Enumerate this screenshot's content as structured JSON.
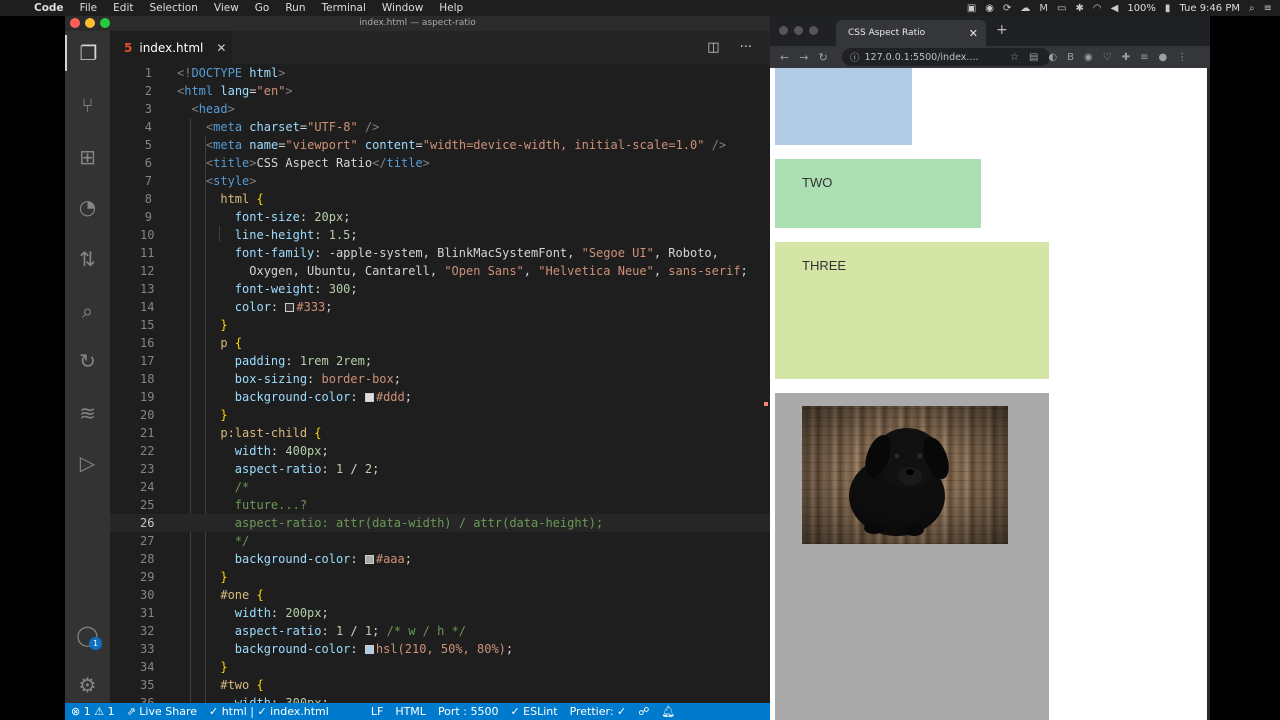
{
  "menubar": {
    "apple": "",
    "items": [
      "Code",
      "File",
      "Edit",
      "Selection",
      "View",
      "Go",
      "Run",
      "Terminal",
      "Window",
      "Help"
    ],
    "battery": "100%",
    "clock": "Tue 9:46 PM"
  },
  "vscode": {
    "window_title": "index.html — aspect-ratio",
    "tab_label": "index.html",
    "activity_badge": "1",
    "lines": [
      {
        "n": "1"
      },
      {
        "n": "2"
      },
      {
        "n": "3"
      },
      {
        "n": "4"
      },
      {
        "n": "5"
      },
      {
        "n": "6"
      },
      {
        "n": "7"
      },
      {
        "n": "8"
      },
      {
        "n": "9"
      },
      {
        "n": "10"
      },
      {
        "n": "11"
      },
      {
        "n": "12"
      },
      {
        "n": "13"
      },
      {
        "n": "14"
      },
      {
        "n": "15"
      },
      {
        "n": "16"
      },
      {
        "n": "17"
      },
      {
        "n": "18"
      },
      {
        "n": "19"
      },
      {
        "n": "20"
      },
      {
        "n": "21"
      },
      {
        "n": "22"
      },
      {
        "n": "23"
      },
      {
        "n": "24"
      },
      {
        "n": "25"
      },
      {
        "n": "26"
      },
      {
        "n": "27"
      },
      {
        "n": "28"
      },
      {
        "n": "29"
      },
      {
        "n": "30"
      },
      {
        "n": "31"
      },
      {
        "n": "32"
      },
      {
        "n": "33"
      },
      {
        "n": "34"
      },
      {
        "n": "35"
      },
      {
        "n": "36"
      }
    ],
    "status": {
      "problems": "⊗ 1 ⚠ 1",
      "live_share": "Live Share",
      "lang_check": "✓ html | ✓ index.html",
      "eol": "LF",
      "language": "HTML",
      "port": "Port : 5500",
      "eslint": "✓ ESLint",
      "prettier": "Prettier: ✓"
    }
  },
  "browser": {
    "tab_title": "CSS Aspect Ratio",
    "url": "127.0.0.1:5500/index....",
    "page": {
      "two": "TWO",
      "three": "THREE"
    }
  },
  "colors": {
    "statusbar": "#007acc",
    "one": "hsl(210, 50%, 80%)",
    "two": "#acdfb1",
    "three": "#d5e5a6",
    "last_child": "#aaa"
  }
}
